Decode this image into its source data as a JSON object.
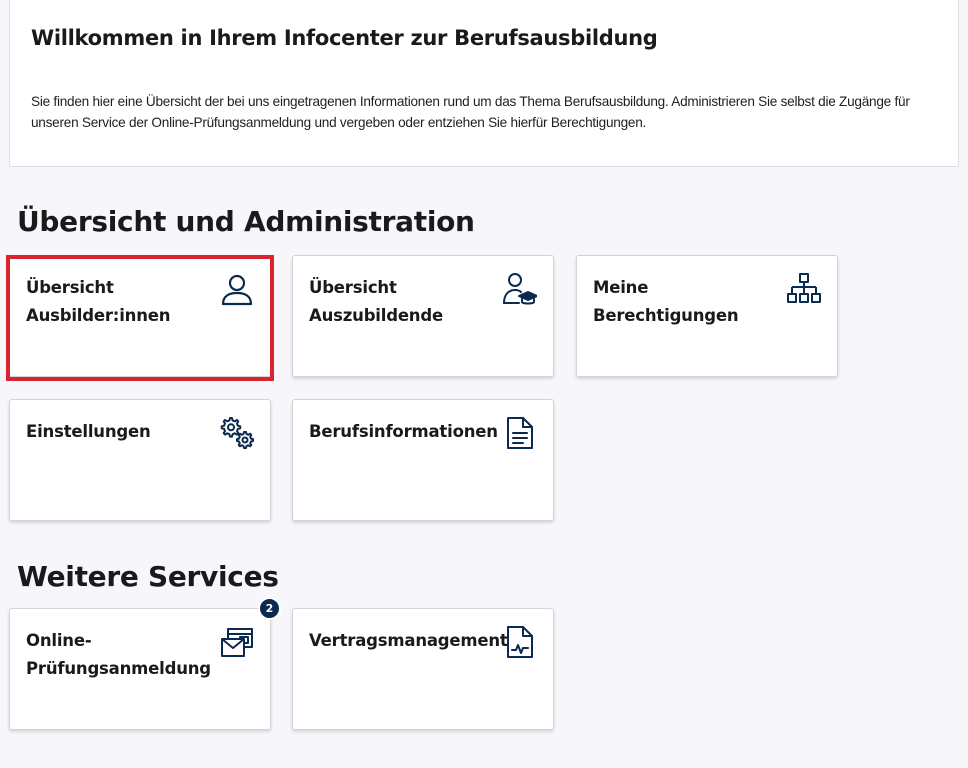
{
  "welcome": {
    "title": "Willkommen in Ihrem Infocenter zur Berufsausbildung",
    "text": "Sie finden hier eine Übersicht der bei uns eingetragenen Informationen rund um das Thema Berufsausbildung. Administrieren Sie selbst die Zugänge für unseren Service der Online-Prüfungsanmeldung und vergeben oder entziehen Sie hierfür Berechtigungen."
  },
  "sections": {
    "admin_title": "Übersicht und Administration",
    "services_title": "Weitere Services"
  },
  "tiles": {
    "ausbilder": {
      "label": "Übersicht Ausbilder:in­nen",
      "icon": "person-icon"
    },
    "auszubildende": {
      "label": "Übersicht Auszubilden­de",
      "icon": "trainee-graduation-icon"
    },
    "berechtigungen": {
      "label": "Meine Berechtigungen",
      "icon": "hierarchy-icon"
    },
    "einstellungen": {
      "label": "Einstellungen",
      "icon": "gears-icon"
    },
    "berufsinfo": {
      "label": "Berufsinformationen",
      "icon": "document-icon"
    },
    "pruefung": {
      "label": "Online-Prüfungsanmeldung",
      "icon": "mail-stack-icon",
      "badge": "2"
    },
    "vertrag": {
      "label": "Vertragsmanagement",
      "icon": "contract-signature-icon"
    }
  },
  "colors": {
    "icon": "#0b2a4f",
    "selection": "#d9232e",
    "badge": "#0b2a4f"
  }
}
